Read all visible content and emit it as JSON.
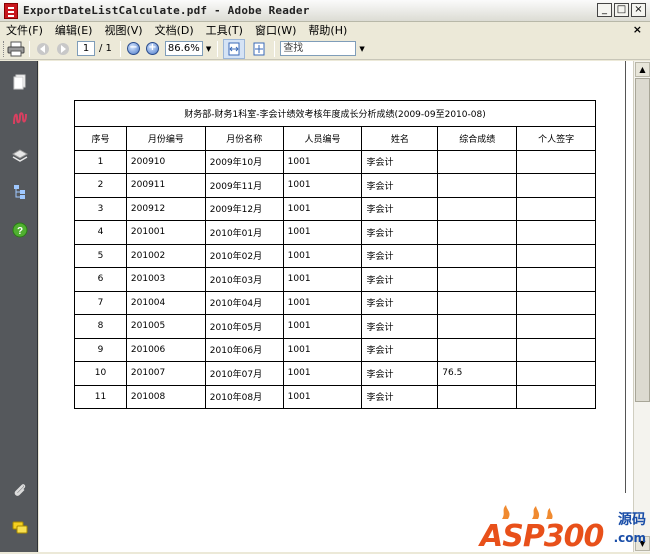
{
  "window": {
    "title": "ExportDateListCalculate.pdf - Adobe Reader"
  },
  "menu": [
    "文件(F)",
    "编辑(E)",
    "视图(V)",
    "文档(D)",
    "工具(T)",
    "窗口(W)",
    "帮助(H)"
  ],
  "toolbar": {
    "page_current": "1",
    "page_total": "/ 1",
    "zoom": "86.6%",
    "search_placeholder": "查找"
  },
  "report": {
    "title": "财务部-财务1科室-李会计绩效考核年度成长分析成绩(2009-09至2010-08)",
    "headers": [
      "序号",
      "月份编号",
      "月份名称",
      "人员编号",
      "姓名",
      "综合成绩",
      "个人签字"
    ],
    "rows": [
      [
        "1",
        "200910",
        "2009年10月",
        "1001",
        "李会计",
        "",
        ""
      ],
      [
        "2",
        "200911",
        "2009年11月",
        "1001",
        "李会计",
        "",
        ""
      ],
      [
        "3",
        "200912",
        "2009年12月",
        "1001",
        "李会计",
        "",
        ""
      ],
      [
        "4",
        "201001",
        "2010年01月",
        "1001",
        "李会计",
        "",
        ""
      ],
      [
        "5",
        "201002",
        "2010年02月",
        "1001",
        "李会计",
        "",
        ""
      ],
      [
        "6",
        "201003",
        "2010年03月",
        "1001",
        "李会计",
        "",
        ""
      ],
      [
        "7",
        "201004",
        "2010年04月",
        "1001",
        "李会计",
        "",
        ""
      ],
      [
        "8",
        "201005",
        "2010年05月",
        "1001",
        "李会计",
        "",
        ""
      ],
      [
        "9",
        "201006",
        "2010年06月",
        "1001",
        "李会计",
        "",
        ""
      ],
      [
        "10",
        "201007",
        "2010年07月",
        "1001",
        "李会计",
        "76.5",
        ""
      ],
      [
        "11",
        "201008",
        "2010年08月",
        "1001",
        "李会计",
        "",
        ""
      ]
    ]
  },
  "watermark": {
    "main": "ASP300",
    "side": "源码",
    "domain": ".com"
  },
  "icons": [
    "print-icon",
    "prev-page-icon",
    "next-page-icon",
    "zoom-out-icon",
    "zoom-in-icon",
    "fit-width-icon",
    "fit-page-icon",
    "pages-icon",
    "signatures-icon",
    "layers-icon",
    "model-tree-icon",
    "help-icon",
    "attachments-icon",
    "comments-icon"
  ],
  "colors": {
    "nav_panel": "#55585c",
    "window_bg": "#ece9d8",
    "accent": "#c8161d"
  }
}
